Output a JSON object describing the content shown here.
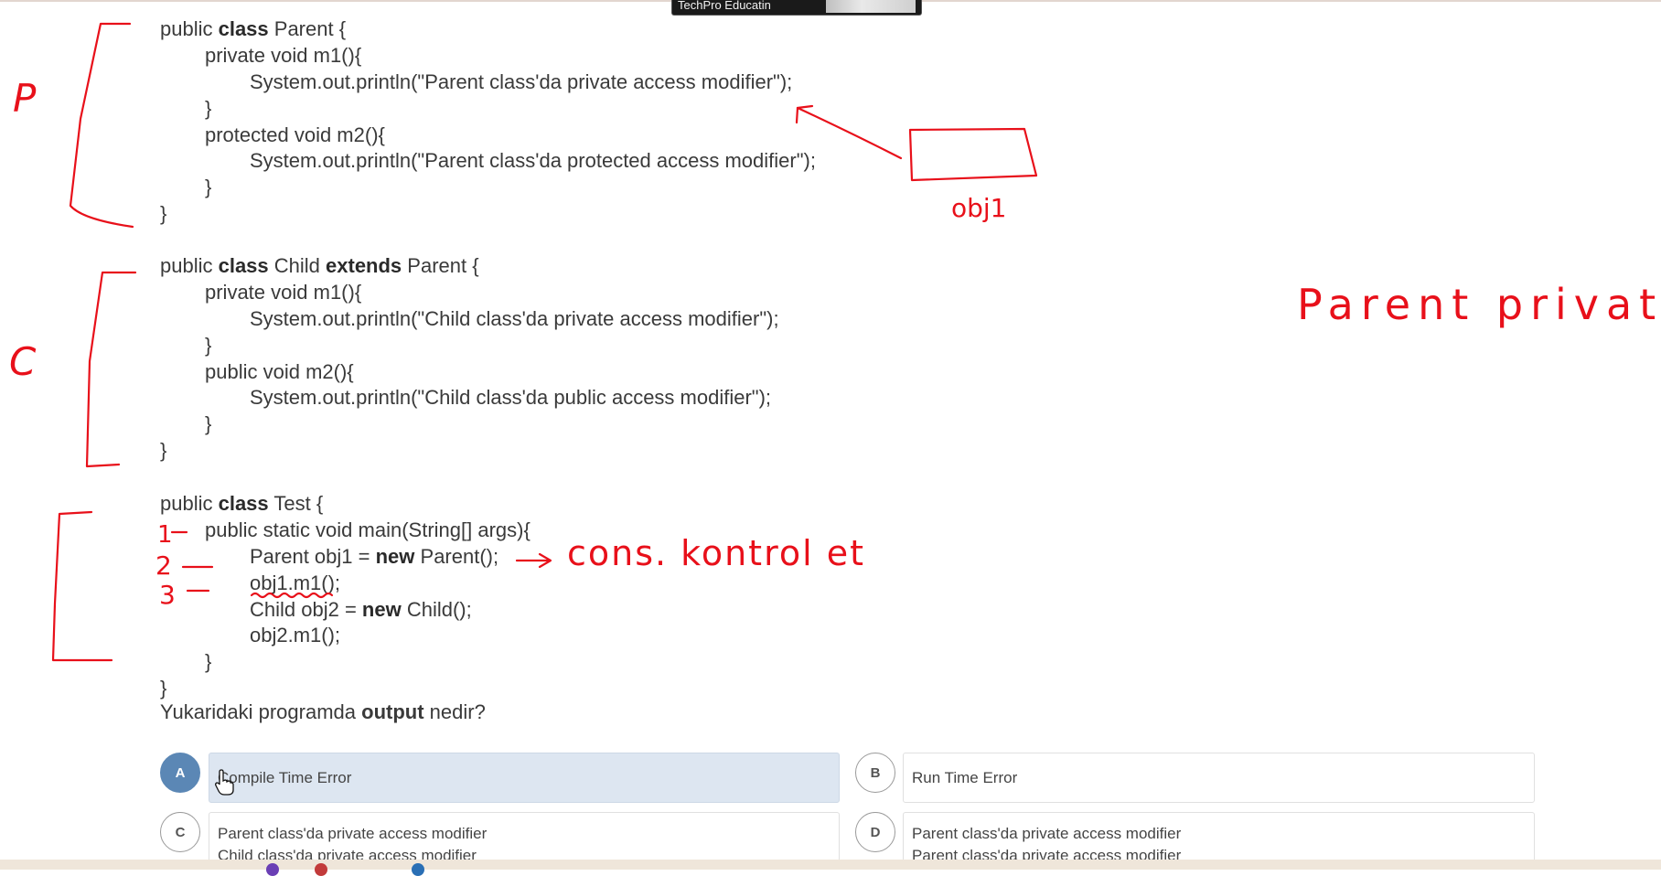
{
  "video_overlay": {
    "label": "TechPro Educatin"
  },
  "code": {
    "parent_class": [
      {
        "indent": 0,
        "parts": [
          {
            "t": "public "
          },
          {
            "t": "class",
            "b": true
          },
          {
            "t": " Parent {"
          }
        ]
      },
      {
        "indent": 1,
        "parts": [
          {
            "t": "private void m1(){"
          }
        ]
      },
      {
        "indent": 2,
        "parts": [
          {
            "t": "System.out.println(\"Parent class'da private access modifier\");"
          }
        ]
      },
      {
        "indent": 1,
        "parts": [
          {
            "t": "}"
          }
        ]
      },
      {
        "indent": 1,
        "parts": [
          {
            "t": "protected void m2(){"
          }
        ]
      },
      {
        "indent": 2,
        "parts": [
          {
            "t": "System.out.println(\"Parent class'da protected access modifier\");"
          }
        ]
      },
      {
        "indent": 1,
        "parts": [
          {
            "t": "}"
          }
        ]
      },
      {
        "indent": 0,
        "parts": [
          {
            "t": "}"
          }
        ]
      }
    ],
    "child_class": [
      {
        "indent": 0,
        "parts": [
          {
            "t": "public "
          },
          {
            "t": "class",
            "b": true
          },
          {
            "t": " Child "
          },
          {
            "t": "extends",
            "b": true
          },
          {
            "t": " Parent {"
          }
        ]
      },
      {
        "indent": 1,
        "parts": [
          {
            "t": "private void m1(){"
          }
        ]
      },
      {
        "indent": 2,
        "parts": [
          {
            "t": "System.out.println(\"Child class'da private access modifier\");"
          }
        ]
      },
      {
        "indent": 1,
        "parts": [
          {
            "t": "}"
          }
        ]
      },
      {
        "indent": 1,
        "parts": [
          {
            "t": "public void m2(){"
          }
        ]
      },
      {
        "indent": 2,
        "parts": [
          {
            "t": "System.out.println(\"Child class'da public access modifier\");"
          }
        ]
      },
      {
        "indent": 1,
        "parts": [
          {
            "t": "}"
          }
        ]
      },
      {
        "indent": 0,
        "parts": [
          {
            "t": "}"
          }
        ]
      }
    ],
    "test_class": [
      {
        "indent": 0,
        "parts": [
          {
            "t": "public "
          },
          {
            "t": "class",
            "b": true
          },
          {
            "t": " Test {"
          }
        ]
      },
      {
        "indent": 1,
        "parts": [
          {
            "t": "public static void main(String[] args){"
          }
        ]
      },
      {
        "indent": 2,
        "parts": [
          {
            "t": "Parent obj1 = "
          },
          {
            "t": "new",
            "b": true
          },
          {
            "t": " Parent();"
          }
        ]
      },
      {
        "indent": 2,
        "parts": [
          {
            "t": "obj1.m1();"
          }
        ]
      },
      {
        "indent": 2,
        "parts": [
          {
            "t": "Child obj2 = "
          },
          {
            "t": "new",
            "b": true
          },
          {
            "t": " Child();"
          }
        ]
      },
      {
        "indent": 2,
        "parts": [
          {
            "t": "obj2.m1();"
          }
        ]
      },
      {
        "indent": 1,
        "parts": [
          {
            "t": "}"
          }
        ]
      },
      {
        "indent": 0,
        "parts": [
          {
            "t": "}"
          }
        ]
      }
    ]
  },
  "question": {
    "prefix": "Yukaridaki programda ",
    "bold": "output",
    "suffix": " nedir?"
  },
  "options": {
    "a": {
      "letter": "A",
      "line1": "Compile Time Error",
      "selected": true
    },
    "b": {
      "letter": "B",
      "line1": "Run Time Error"
    },
    "c": {
      "letter": "C",
      "line1": "Parent class'da private access modifier",
      "line2": "Child class'da private access modifier"
    },
    "d": {
      "letter": "D",
      "line1": "Parent class'da private access modifier",
      "line2": "Parent class'da private access modifier"
    }
  },
  "handwriting": {
    "label_p": "P",
    "label_c": "C",
    "obj_box_label": "obj1",
    "note_right": "Parent private.",
    "step_1": "1",
    "step_2": "2",
    "step_3": "3",
    "note_cons": "cons. kontrol et"
  },
  "colors": {
    "ink": "#e8101a",
    "selected": "#5b87b5",
    "selected_bg": "#dde6f1"
  }
}
